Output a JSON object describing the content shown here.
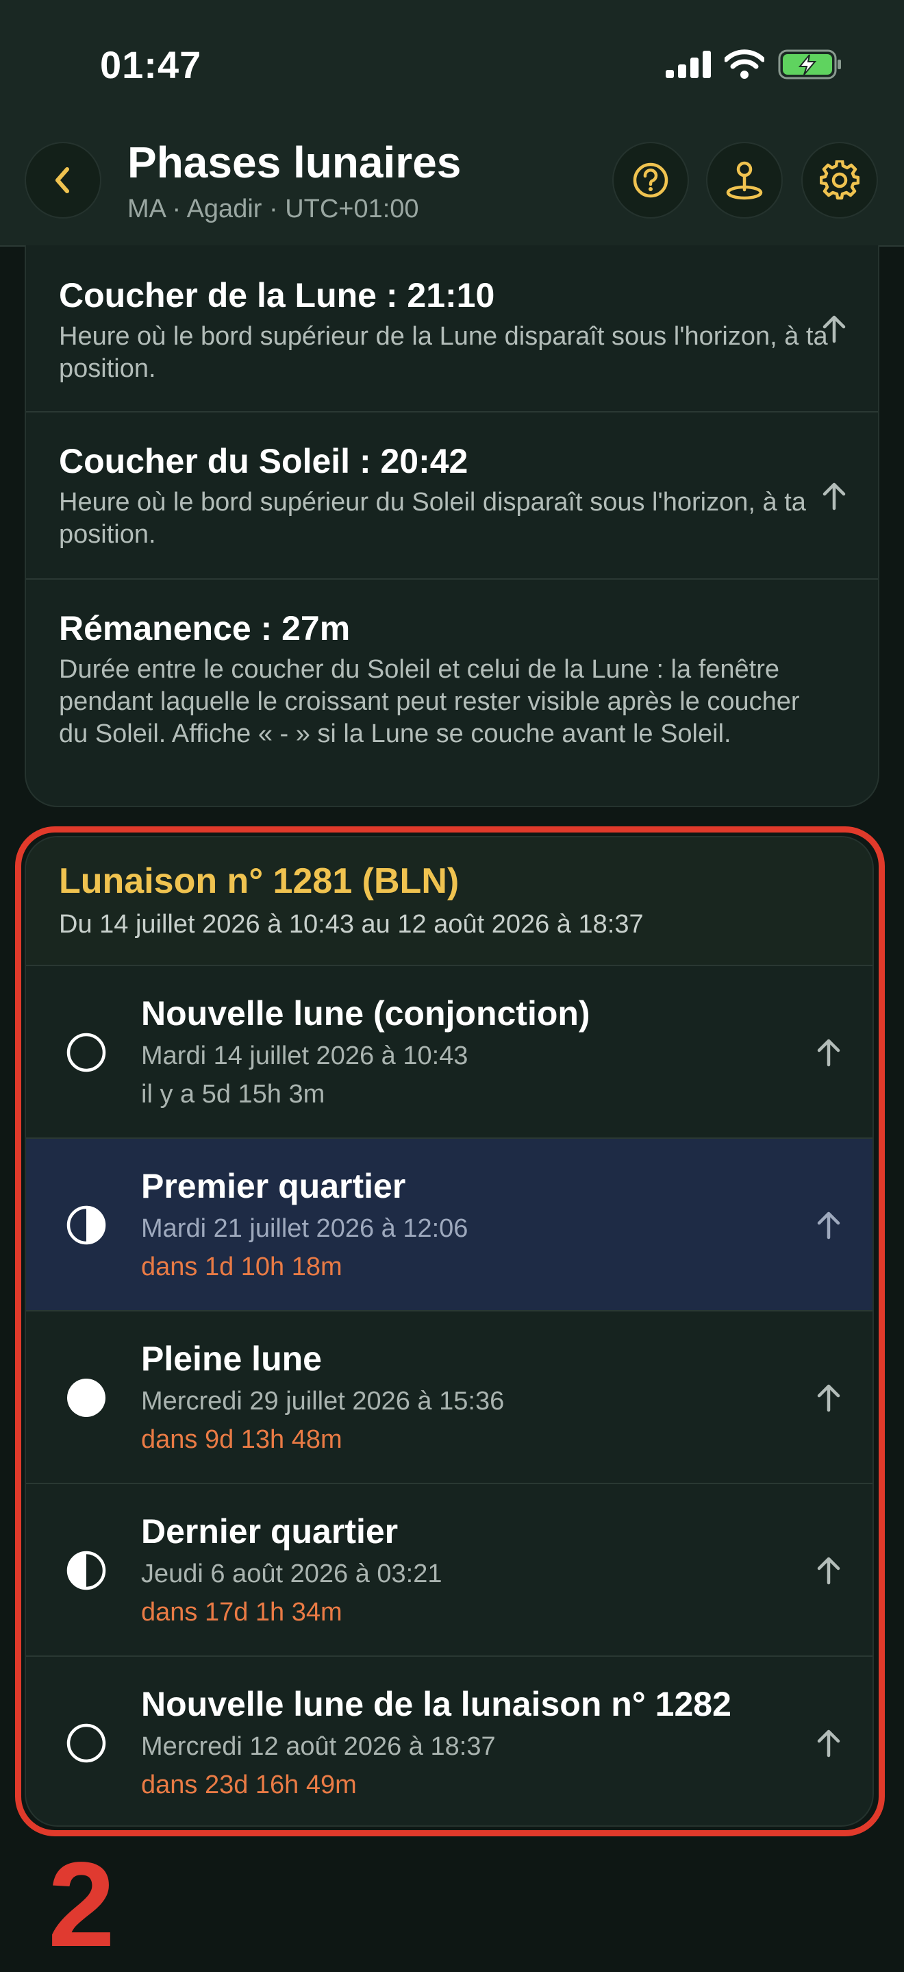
{
  "status_bar": {
    "time": "01:47"
  },
  "header": {
    "title": "Phases lunaires",
    "subtitle": "MA · Agadir · UTC+01:00",
    "icons": [
      "back-chevron",
      "help-circle",
      "location-pin",
      "gear"
    ]
  },
  "info_rows": [
    {
      "title": "Coucher de la Lune : 21:10",
      "description": "Heure où le bord supérieur de la Lune disparaît sous l'horizon, à ta position."
    },
    {
      "title": "Coucher du Soleil : 20:42",
      "description": "Heure où le bord supérieur du Soleil disparaît sous l'horizon, à ta position."
    },
    {
      "title": "Rémanence : 27m",
      "description": "Durée entre le coucher du Soleil et celui de la Lune : la fenêtre pendant laquelle le croissant peut rester visible après le coucher du Soleil. Affiche « - » si la Lune se couche avant le Soleil."
    }
  ],
  "lunation": {
    "title": "Lunaison n° 1281 (BLN)",
    "range": "Du 14 juillet 2026 à 10:43 au 12 août 2026 à 18:37",
    "phases": [
      {
        "name": "Nouvelle lune (conjonction)",
        "date": "Mardi 14 juillet 2026 à 10:43",
        "relative": "il y a 5d 15h 3m",
        "icon": "new-moon"
      },
      {
        "name": "Premier quartier",
        "date": "Mardi 21 juillet 2026 à 12:06",
        "relative": "dans 1d 10h 18m",
        "icon": "first-quarter"
      },
      {
        "name": "Pleine lune",
        "date": "Mercredi 29 juillet 2026 à 15:36",
        "relative": "dans 9d 13h 48m",
        "icon": "full-moon"
      },
      {
        "name": "Dernier quartier",
        "date": "Jeudi 6 août 2026 à 03:21",
        "relative": "dans 17d 1h 34m",
        "icon": "last-quarter"
      },
      {
        "name": "Nouvelle lune de la lunaison n° 1282",
        "date": "Mercredi 12 août 2026 à 18:37",
        "relative": "dans 23d 16h 49m",
        "icon": "new-moon"
      }
    ]
  },
  "annotation": {
    "step_number": "2"
  },
  "colors": {
    "accent": "#f0c350",
    "future": "#ea7b45",
    "highlight_row": "#1e2b45",
    "annotation_red": "#e13a2b",
    "background": "#0e1714",
    "card": "#16231f"
  }
}
